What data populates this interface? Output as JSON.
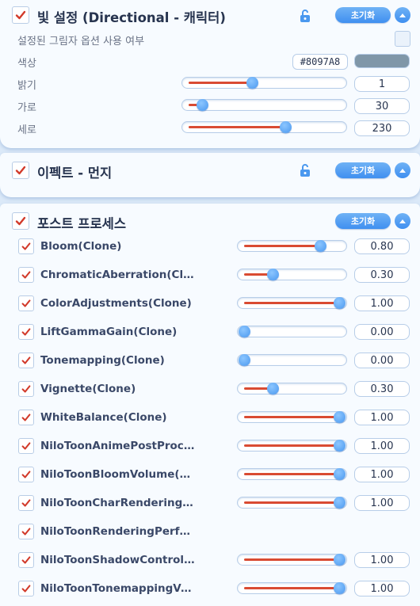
{
  "light": {
    "title": "빛 설정 (Directional - 캐릭터)",
    "enabled": true,
    "reset_label": "초기화",
    "shadow_option_label": "설정된 그림자 옵션 사용 여부",
    "shadow_option_enabled": false,
    "color_label": "색상",
    "color_hex": "#8097A8",
    "color_swatch": "#8097a8",
    "brightness": {
      "label": "밝기",
      "value": "1",
      "fraction": 0.42
    },
    "horizontal": {
      "label": "가로",
      "value": "30",
      "fraction": 0.09
    },
    "vertical": {
      "label": "세로",
      "value": "230",
      "fraction": 0.64
    }
  },
  "effect": {
    "title": "이펙트 - 먼지",
    "enabled": true,
    "reset_label": "초기화"
  },
  "post": {
    "title": "포스트 프로세스",
    "enabled": true,
    "reset_label": "초기화",
    "items": [
      {
        "label": "Bloom(Clone)",
        "value": "0.80",
        "fraction": 0.8,
        "has_slider": true
      },
      {
        "label": "ChromaticAberration(Clo…",
        "value": "0.30",
        "fraction": 0.3,
        "has_slider": true
      },
      {
        "label": "ColorAdjustments(Clone)",
        "value": "1.00",
        "fraction": 1.0,
        "has_slider": true
      },
      {
        "label": "LiftGammaGain(Clone)",
        "value": "0.00",
        "fraction": 0.0,
        "has_slider": true
      },
      {
        "label": "Tonemapping(Clone)",
        "value": "0.00",
        "fraction": 0.0,
        "has_slider": true
      },
      {
        "label": "Vignette(Clone)",
        "value": "0.30",
        "fraction": 0.3,
        "has_slider": true
      },
      {
        "label": "WhiteBalance(Clone)",
        "value": "1.00",
        "fraction": 1.0,
        "has_slider": true
      },
      {
        "label": "NiloToonAnimePostProce…",
        "value": "1.00",
        "fraction": 1.0,
        "has_slider": true
      },
      {
        "label": "NiloToonBloomVolume(Cl…",
        "value": "1.00",
        "fraction": 1.0,
        "has_slider": true
      },
      {
        "label": "NiloToonCharRenderingC…",
        "value": "1.00",
        "fraction": 1.0,
        "has_slider": true
      },
      {
        "label": "NiloToonRenderingPerfor…",
        "value": "",
        "fraction": 0,
        "has_slider": false
      },
      {
        "label": "NiloToonShadowControlV…",
        "value": "1.00",
        "fraction": 1.0,
        "has_slider": true
      },
      {
        "label": "NiloToonTonemappingVol…",
        "value": "1.00",
        "fraction": 1.0,
        "has_slider": true
      }
    ]
  },
  "colors": {
    "accent": "#4a98ef",
    "slider_fill": "#d94b32",
    "check": "#d23a2a"
  }
}
